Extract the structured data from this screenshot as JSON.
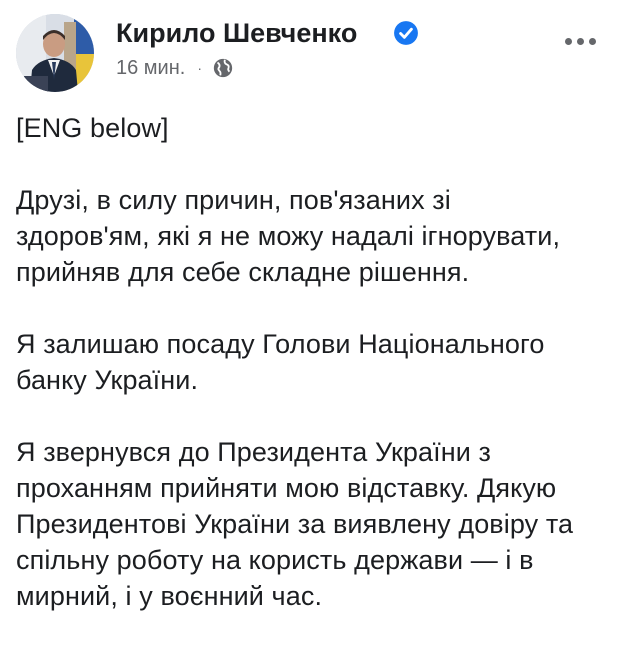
{
  "post": {
    "author_name": "Кирило Шевченко",
    "timestamp": "16 мин.",
    "separator": "·",
    "audience_icon": "globe-icon",
    "verified_icon": "verified-badge-icon",
    "more_icon": "more-options-icon",
    "paragraphs": [
      "[ENG below]",
      "Друзі, в силу причин, пов'язаних зі\nздоров'ям, які я не можу надалі ігнорувати,\nприйняв для себе складне рішення.",
      "Я залишаю посаду Голови Національного\nбанку України.",
      "Я звернувся до Президента України з\nпроханням прийняти мою відставку. Дякую\nПрезидентові України за виявлену довіру та\nспільну роботу на користь держави — і в\nмирний, і у воєнний час."
    ]
  },
  "colors": {
    "text": "#1c1e21",
    "meta": "#65676b",
    "verified": "#1877f2",
    "background": "#ffffff"
  }
}
